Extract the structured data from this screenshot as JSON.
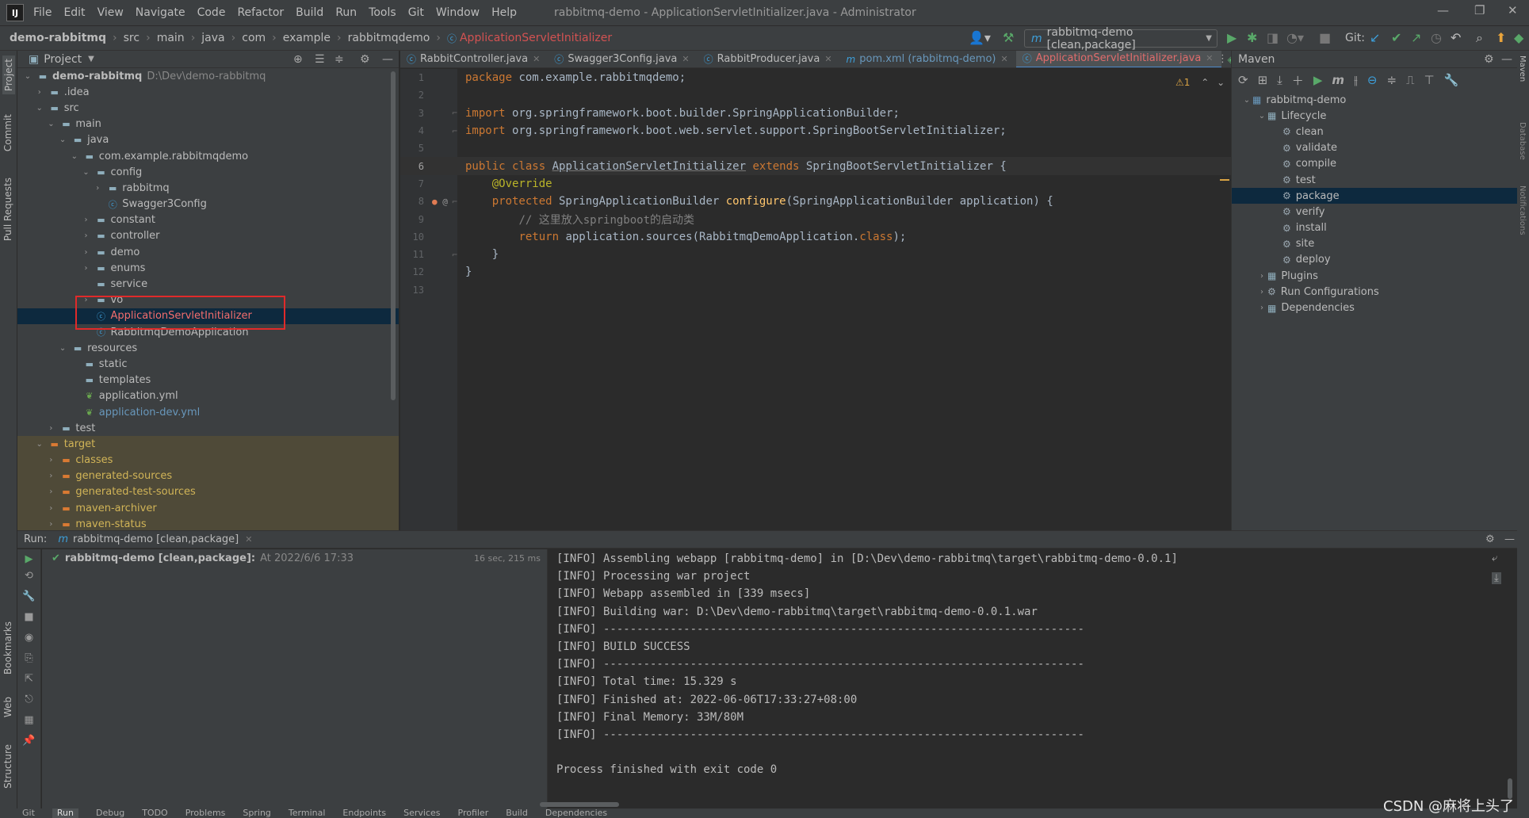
{
  "menubar": {
    "items": [
      "File",
      "Edit",
      "View",
      "Navigate",
      "Code",
      "Refactor",
      "Build",
      "Run",
      "Tools",
      "Git",
      "Window",
      "Help"
    ],
    "window_title": "rabbitmq-demo - ApplicationServletInitializer.java - Administrator"
  },
  "navbar": {
    "breadcrumbs": [
      "demo-rabbitmq",
      "src",
      "main",
      "java",
      "com",
      "example",
      "rabbitmqdemo"
    ],
    "active_file": "ApplicationServletInitializer",
    "run_config": "rabbitmq-demo [clean,package]",
    "git_label": "Git:"
  },
  "left_strip": [
    "Project",
    "Commit",
    "Pull Requests",
    "Bookmarks",
    "Web",
    "Structure"
  ],
  "project": {
    "title": "Project",
    "tree": [
      {
        "label": "demo-rabbitmq",
        "extra": "D:\\Dev\\demo-rabbitmq",
        "depth": 0,
        "arrow": "v",
        "icon": "module"
      },
      {
        "label": ".idea",
        "depth": 1,
        "arrow": ">",
        "icon": "folder"
      },
      {
        "label": "src",
        "depth": 1,
        "arrow": "v",
        "icon": "folder"
      },
      {
        "label": "main",
        "depth": 2,
        "arrow": "v",
        "icon": "folder"
      },
      {
        "label": "java",
        "depth": 3,
        "arrow": "v",
        "icon": "folder"
      },
      {
        "label": "com.example.rabbitmqdemo",
        "depth": 4,
        "arrow": "v",
        "icon": "folder"
      },
      {
        "label": "config",
        "depth": 5,
        "arrow": "v",
        "icon": "folder"
      },
      {
        "label": "rabbitmq",
        "depth": 6,
        "arrow": ">",
        "icon": "folder"
      },
      {
        "label": "Swagger3Config",
        "depth": 6,
        "arrow": "",
        "icon": "class"
      },
      {
        "label": "constant",
        "depth": 5,
        "arrow": ">",
        "icon": "folder"
      },
      {
        "label": "controller",
        "depth": 5,
        "arrow": ">",
        "icon": "folder"
      },
      {
        "label": "demo",
        "depth": 5,
        "arrow": ">",
        "icon": "folder"
      },
      {
        "label": "enums",
        "depth": 5,
        "arrow": ">",
        "icon": "folder"
      },
      {
        "label": "service",
        "depth": 5,
        "arrow": "",
        "icon": "folder"
      },
      {
        "label": "vo",
        "depth": 5,
        "arrow": ">",
        "icon": "folder"
      },
      {
        "label": "ApplicationServletInitializer",
        "depth": 5,
        "arrow": "",
        "icon": "class",
        "selected": true
      },
      {
        "label": "RabbitmqDemoApplication",
        "depth": 5,
        "arrow": "",
        "icon": "class"
      },
      {
        "label": "resources",
        "depth": 3,
        "arrow": "v",
        "icon": "folder"
      },
      {
        "label": "static",
        "depth": 4,
        "arrow": "",
        "icon": "folder"
      },
      {
        "label": "templates",
        "depth": 4,
        "arrow": "",
        "icon": "folder"
      },
      {
        "label": "application.yml",
        "depth": 4,
        "arrow": "",
        "icon": "yml"
      },
      {
        "label": "application-dev.yml",
        "depth": 4,
        "arrow": "",
        "icon": "yml",
        "blue": true
      },
      {
        "label": "test",
        "depth": 2,
        "arrow": ">",
        "icon": "folder"
      },
      {
        "label": "target",
        "depth": 1,
        "arrow": "v",
        "icon": "folder-orange",
        "target": true
      },
      {
        "label": "classes",
        "depth": 2,
        "arrow": ">",
        "icon": "folder-orange",
        "target": true
      },
      {
        "label": "generated-sources",
        "depth": 2,
        "arrow": ">",
        "icon": "folder-orange",
        "target": true
      },
      {
        "label": "generated-test-sources",
        "depth": 2,
        "arrow": ">",
        "icon": "folder-orange",
        "target": true
      },
      {
        "label": "maven-archiver",
        "depth": 2,
        "arrow": ">",
        "icon": "folder-orange",
        "target": true
      },
      {
        "label": "maven-status",
        "depth": 2,
        "arrow": ">",
        "icon": "folder-orange",
        "target": true
      }
    ]
  },
  "editor": {
    "tabs": [
      {
        "label": "RabbitController.java",
        "icon": "C"
      },
      {
        "label": "Swagger3Config.java",
        "icon": "C"
      },
      {
        "label": "RabbitProducer.java",
        "icon": "C"
      },
      {
        "label": "pom.xml (rabbitmq-demo)",
        "icon": "m"
      },
      {
        "label": "ApplicationServletInitializer.java",
        "icon": "C",
        "active": true
      },
      {
        "label": "e",
        "icon": "e"
      }
    ],
    "warnings": "⚠1",
    "lines": [
      {
        "n": "1",
        "html": "<span class='kw'>package</span> com.example.rabbitmqdemo;"
      },
      {
        "n": "2",
        "html": ""
      },
      {
        "n": "3",
        "html": "<span class='kw'>import</span> org.springframework.boot.builder.SpringApplicationBuilder;"
      },
      {
        "n": "4",
        "html": "<span class='kw'>import</span> org.springframework.boot.web.servlet.support.SpringBootServletInitializer;"
      },
      {
        "n": "5",
        "html": ""
      },
      {
        "n": "6",
        "html": "<span class='kw'>public class</span> <span class='uln'>ApplicationServletInitializer</span> <span class='kw'>extends</span> SpringBootServletInitializer {",
        "cur": true
      },
      {
        "n": "7",
        "html": "    <span class='an'>@Override</span>"
      },
      {
        "n": "8",
        "html": "    <span class='kw'>protected</span> SpringApplicationBuilder <span class='fn'>configure</span>(SpringApplicationBuilder application) {"
      },
      {
        "n": "9",
        "html": "        <span class='cm'>// 这里放入springboot的启动类</span>"
      },
      {
        "n": "10",
        "html": "        <span class='kw'>return</span> application.sources(RabbitmqDemoApplication.<span class='kw'>class</span>);"
      },
      {
        "n": "11",
        "html": "    }"
      },
      {
        "n": "12",
        "html": "}"
      },
      {
        "n": "13",
        "html": ""
      }
    ]
  },
  "maven": {
    "title": "Maven",
    "items": [
      {
        "label": "rabbitmq-demo",
        "depth": 0,
        "arrow": "v",
        "icon": "module"
      },
      {
        "label": "Lifecycle",
        "depth": 1,
        "arrow": "v",
        "icon": "folder"
      },
      {
        "label": "clean",
        "depth": 2,
        "arrow": "",
        "icon": "gear"
      },
      {
        "label": "validate",
        "depth": 2,
        "arrow": "",
        "icon": "gear"
      },
      {
        "label": "compile",
        "depth": 2,
        "arrow": "",
        "icon": "gear"
      },
      {
        "label": "test",
        "depth": 2,
        "arrow": "",
        "icon": "gear"
      },
      {
        "label": "package",
        "depth": 2,
        "arrow": "",
        "icon": "gear",
        "selected": true
      },
      {
        "label": "verify",
        "depth": 2,
        "arrow": "",
        "icon": "gear"
      },
      {
        "label": "install",
        "depth": 2,
        "arrow": "",
        "icon": "gear"
      },
      {
        "label": "site",
        "depth": 2,
        "arrow": "",
        "icon": "gear"
      },
      {
        "label": "deploy",
        "depth": 2,
        "arrow": "",
        "icon": "gear"
      },
      {
        "label": "Plugins",
        "depth": 1,
        "arrow": ">",
        "icon": "folder"
      },
      {
        "label": "Run Configurations",
        "depth": 1,
        "arrow": ">",
        "icon": "gear"
      },
      {
        "label": "Dependencies",
        "depth": 1,
        "arrow": ">",
        "icon": "folder"
      }
    ]
  },
  "run": {
    "label": "Run:",
    "tab": "rabbitmq-demo [clean,package]",
    "entry_name": "rabbitmq-demo [clean,package]:",
    "entry_time": "At 2022/6/6 17:33",
    "entry_duration": "16 sec, 215 ms",
    "console": [
      "[INFO] Assembling webapp [rabbitmq-demo] in [D:\\Dev\\demo-rabbitmq\\target\\rabbitmq-demo-0.0.1]",
      "[INFO] Processing war project",
      "[INFO] Webapp assembled in [339 msecs]",
      "[INFO] Building war: D:\\Dev\\demo-rabbitmq\\target\\rabbitmq-demo-0.0.1.war",
      "[INFO] ------------------------------------------------------------------------",
      "[INFO] BUILD SUCCESS",
      "[INFO] ------------------------------------------------------------------------",
      "[INFO] Total time: 15.329 s",
      "[INFO] Finished at: 2022-06-06T17:33:27+08:00",
      "[INFO] Final Memory: 33M/80M",
      "[INFO] ------------------------------------------------------------------------",
      "",
      "Process finished with exit code 0"
    ]
  },
  "statusbar": [
    "Git",
    "Run",
    "Debug",
    "TODO",
    "Problems",
    "Spring",
    "Terminal",
    "Endpoints",
    "Services",
    "Profiler",
    "Build",
    "Dependencies"
  ],
  "watermark": "CSDN @麻将上头了"
}
